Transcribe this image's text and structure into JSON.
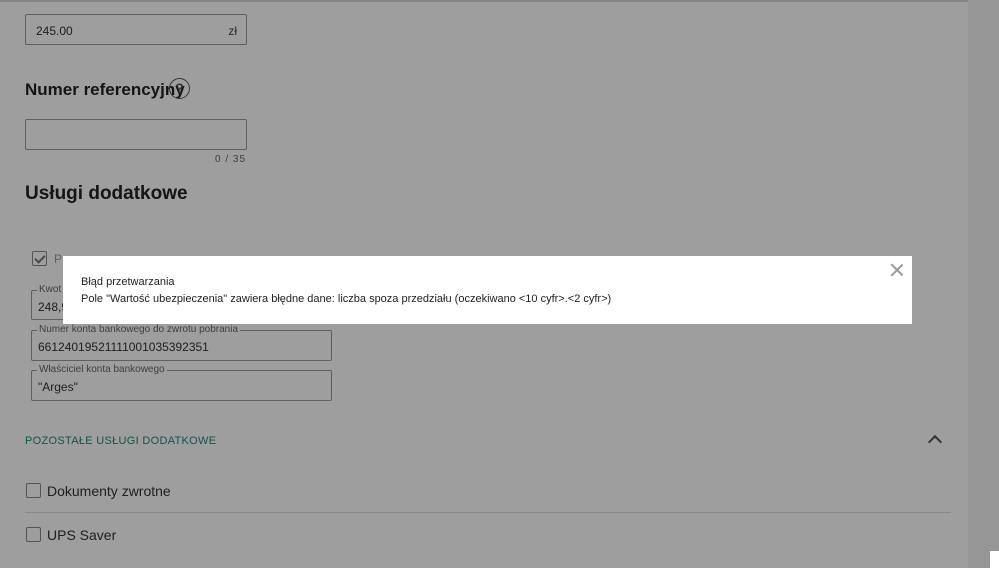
{
  "form": {
    "amount_value": "245.00",
    "amount_unit": "zł",
    "reference_title": "Numer referencyjny",
    "reference_help": "?",
    "reference_value": "",
    "reference_counter": "0 / 35",
    "services_title": "Usługi dodatkowe",
    "cod_checkbox_label": "P",
    "cod_amount_legend": "Kwot",
    "cod_amount_value": "248,9",
    "bank_account_legend": "Numer konta bankowego do zwrotu pobrania",
    "bank_account_value": "66124019521111001035392351",
    "account_owner_legend": "Właściciel konta bankowego",
    "account_owner_value": "\"Arges\"",
    "other_services_title": "POZOSTAŁE USŁUGI DODATKOWE",
    "return_docs_label": "Dokumenty zwrotne",
    "ups_saver_label": "UPS Saver"
  },
  "modal": {
    "title": "Błąd przetwarzania",
    "message": "Pole \"Wartość ubezpieczenia\" zawiera błędne dane: liczba spoza przedziału (oczekiwano <10 cyfr>.<2 cyfr>)"
  }
}
